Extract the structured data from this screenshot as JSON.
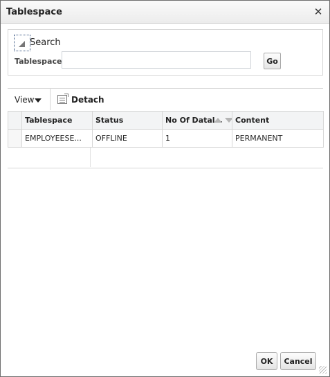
{
  "dialog": {
    "title": "Tablespace",
    "close_glyph": "✕"
  },
  "search": {
    "heading": "Search",
    "field_label": "Tablespace",
    "field_value": "",
    "go_label": "Go"
  },
  "toolbar": {
    "view_label": "View",
    "detach_label": "Detach"
  },
  "table": {
    "columns": [
      "Tablespace",
      "Status",
      "No Of Datal",
      "Content"
    ],
    "rows": [
      [
        "EMPLOYEESE...",
        "OFFLINE",
        "1",
        "PERMANENT"
      ]
    ]
  },
  "buttons": {
    "ok": "OK",
    "cancel": "Cancel"
  },
  "icons": {
    "close": "close-icon",
    "disclosure": "disclosure-triangle-icon",
    "view_caret": "caret-down-icon",
    "detach": "detach-icon",
    "sort": "sort-arrows-icon",
    "resize": "resize-grip-icon"
  },
  "colors": {
    "border": "#d6d6d6",
    "header_bg": "#f3f4f5",
    "focus_outline": "#3d5a85"
  }
}
